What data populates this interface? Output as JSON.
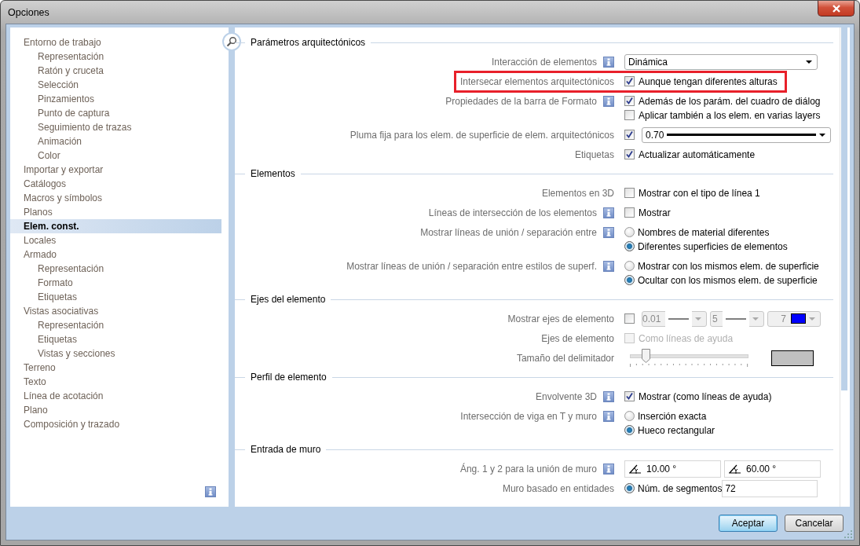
{
  "window": {
    "title": "Opciones"
  },
  "sidebar": {
    "items": [
      {
        "label": "Entorno de trabajo",
        "selected": false,
        "children": [
          {
            "label": "Representación",
            "selected": false
          },
          {
            "label": "Ratón y cruceta",
            "selected": false
          },
          {
            "label": "Selección",
            "selected": false
          },
          {
            "label": "Pinzamientos",
            "selected": false
          },
          {
            "label": "Punto de captura",
            "selected": false
          },
          {
            "label": "Seguimiento de trazas",
            "selected": false
          },
          {
            "label": "Animación",
            "selected": false
          },
          {
            "label": "Color",
            "selected": false
          }
        ]
      },
      {
        "label": "Importar y exportar",
        "selected": false
      },
      {
        "label": "Catálogos",
        "selected": false
      },
      {
        "label": "Macros y símbolos",
        "selected": false
      },
      {
        "label": "Planos",
        "selected": false
      },
      {
        "label": "Elem. const.",
        "selected": true
      },
      {
        "label": "Locales",
        "selected": false
      },
      {
        "label": "Armado",
        "selected": false,
        "children": [
          {
            "label": "Representación",
            "selected": false
          },
          {
            "label": "Formato",
            "selected": false
          },
          {
            "label": "Etiquetas",
            "selected": false
          }
        ]
      },
      {
        "label": "Vistas asociativas",
        "selected": false,
        "children": [
          {
            "label": "Representación",
            "selected": false
          },
          {
            "label": "Etiquetas",
            "selected": false
          },
          {
            "label": "Vistas y secciones",
            "selected": false
          }
        ]
      },
      {
        "label": "Terreno",
        "selected": false
      },
      {
        "label": "Texto",
        "selected": false
      },
      {
        "label": "Línea de acotación",
        "selected": false
      },
      {
        "label": "Plano",
        "selected": false
      },
      {
        "label": "Composición y trazado",
        "selected": false
      }
    ],
    "info": true
  },
  "sections": [
    {
      "title": "Parámetros arquitectónicos",
      "rows": [
        {
          "label": "Interacción de elementos",
          "info": true,
          "lines": [
            [
              {
                "kind": "dropdown",
                "value": "Dinámica"
              }
            ]
          ]
        },
        {
          "label": "Intersecar elementos arquitectónicos",
          "info": false,
          "highlighted": true,
          "lines": [
            [
              {
                "kind": "checkbox",
                "label": "Aunque tengan diferentes alturas",
                "checked": true
              }
            ]
          ]
        },
        {
          "label": "Propiedades de la barra de Formato",
          "info": true,
          "lines": [
            [
              {
                "kind": "checkbox",
                "label": "Además de los parám. del cuadro de diálog",
                "checked": true
              }
            ],
            [
              {
                "kind": "checkbox",
                "label": "Aplicar también a los elem. en varias layers",
                "checked": false
              }
            ]
          ]
        },
        {
          "label": "Pluma fija para los elem. de superficie de elem. arquitectónicos",
          "info": false,
          "lines": [
            [
              {
                "kind": "checkbox",
                "checked": true
              },
              {
                "kind": "pen_dropdown",
                "value": "0.70"
              }
            ]
          ]
        },
        {
          "label": "Etiquetas",
          "info": false,
          "lines": [
            [
              {
                "kind": "checkbox",
                "label": "Actualizar automáticamente",
                "checked": true
              }
            ]
          ]
        }
      ]
    },
    {
      "title": "Elementos",
      "rows": [
        {
          "label": "Elementos en 3D",
          "info": false,
          "lines": [
            [
              {
                "kind": "checkbox",
                "label": "Mostrar con el tipo de línea 1",
                "checked": false
              }
            ]
          ]
        },
        {
          "label": "Líneas de intersección de los elementos",
          "info": true,
          "lines": [
            [
              {
                "kind": "checkbox",
                "label": "Mostrar",
                "checked": false
              }
            ]
          ]
        },
        {
          "label": "Mostrar líneas de unión / separación entre",
          "info": true,
          "lines": [
            [
              {
                "kind": "radio",
                "label": "Nombres de material diferentes",
                "selected": false
              }
            ],
            [
              {
                "kind": "radio",
                "label": "Diferentes superficies de elementos",
                "selected": true
              }
            ]
          ]
        },
        {
          "label": "Mostrar líneas de unión / separación entre estilos de superf.",
          "info": true,
          "lines": [
            [
              {
                "kind": "radio",
                "label": "Mostrar con los mismos elem. de superficie",
                "selected": false
              }
            ],
            [
              {
                "kind": "radio",
                "label": "Ocultar con los mismos elem. de superficie",
                "selected": true
              }
            ]
          ]
        }
      ]
    },
    {
      "title": "Ejes del elemento",
      "rows": [
        {
          "label": "Mostrar ejes de elemento",
          "info": false,
          "lines": [
            [
              {
                "kind": "checkbox",
                "checked": false
              },
              {
                "kind": "line_combo",
                "value": "0.01",
                "disabled": true
              },
              {
                "kind": "line_combo",
                "value": "5",
                "disabled": true
              },
              {
                "kind": "color_combo",
                "value": "7",
                "color": "#0000ff",
                "disabled": true
              }
            ]
          ]
        },
        {
          "label": "Ejes de elemento",
          "info": false,
          "lines": [
            [
              {
                "kind": "checkbox",
                "label": "Como líneas de ayuda",
                "checked": false,
                "disabled": true
              }
            ]
          ]
        },
        {
          "label": "Tamaño del delimitador",
          "info": false,
          "lines": [
            [
              {
                "kind": "slider",
                "level": 0.13
              },
              {
                "kind": "swatch",
                "color": "#c0c0c0"
              }
            ]
          ]
        }
      ]
    },
    {
      "title": "Perfil de elemento",
      "rows": [
        {
          "label": "Envolvente 3D",
          "info": true,
          "lines": [
            [
              {
                "kind": "checkbox",
                "label": "Mostrar (como líneas de ayuda)",
                "checked": true
              }
            ]
          ]
        },
        {
          "label": "Intersección de viga en T y muro",
          "info": true,
          "lines": [
            [
              {
                "kind": "radio",
                "label": "Inserción exacta",
                "selected": false
              }
            ],
            [
              {
                "kind": "radio",
                "label": "Hueco rectangular",
                "selected": true
              }
            ]
          ]
        }
      ]
    },
    {
      "title": "Entrada de muro",
      "rows": [
        {
          "label": "Áng. 1 y 2 para la unión de muro",
          "info": true,
          "lines": [
            [
              {
                "kind": "angle_field",
                "value": "10.00 °"
              },
              {
                "kind": "angle_field",
                "value": "60.00 °"
              }
            ]
          ]
        },
        {
          "label": "Muro basado en entidades",
          "info": false,
          "lines": [
            [
              {
                "kind": "radio",
                "label": "Núm. de segmentos",
                "selected": true
              },
              {
                "kind": "text_field",
                "value": "72"
              }
            ]
          ]
        }
      ]
    }
  ],
  "buttons": [
    {
      "label": "Aceptar",
      "default": true
    },
    {
      "label": "Cancelar",
      "default": false
    }
  ]
}
